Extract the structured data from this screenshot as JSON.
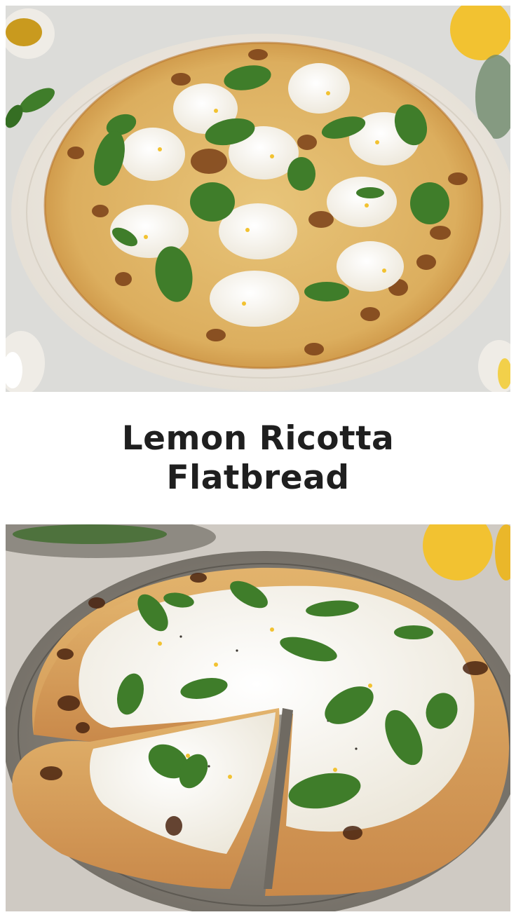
{
  "title": {
    "line1": "Lemon Ricotta",
    "line2": "Flatbread"
  },
  "photos": {
    "top": {
      "subject": "whole flatbread on plate"
    },
    "bottom": {
      "subject": "sliced flatbread on plate"
    }
  },
  "colors": {
    "background": "#ffffff",
    "title_text": "#1f1f1f",
    "crust": "#d9a55a",
    "char": "#6b3a1a",
    "ricotta": "#f7f4ec",
    "basil": "#3f7d2a",
    "lemon": "#f2c231"
  }
}
